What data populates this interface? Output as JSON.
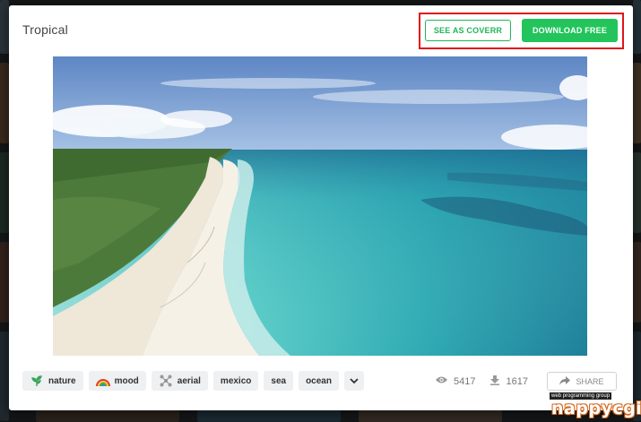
{
  "modal": {
    "title": "Tropical",
    "see_as_coverr_label": "SEE AS COVERR",
    "download_label": "DOWNLOAD FREE",
    "accent_color": "#23c45c",
    "highlight_color": "#e0141b"
  },
  "video": {
    "description_icon": "video-preview"
  },
  "tags": [
    {
      "label": "nature",
      "icon": "plant-icon"
    },
    {
      "label": "mood",
      "icon": "rainbow-icon"
    },
    {
      "label": "aerial",
      "icon": "drone-icon"
    },
    {
      "label": "mexico"
    },
    {
      "label": "sea"
    },
    {
      "label": "ocean"
    }
  ],
  "more_tags_icon": "chevron-down-icon",
  "stats": {
    "views": "5417",
    "views_icon": "eye-icon",
    "downloads": "1617",
    "downloads_icon": "download-icon"
  },
  "share_label": "SHARE",
  "watermark": {
    "small": "web programming group",
    "big": "nappycgi"
  }
}
